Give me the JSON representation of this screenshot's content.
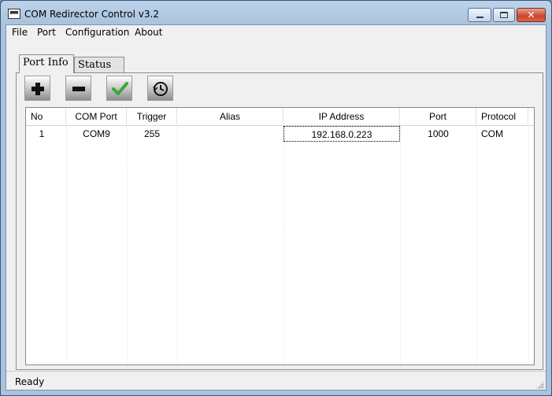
{
  "window": {
    "title": "COM Redirector Control v3.2",
    "min_symbol": "–",
    "max_symbol": "□",
    "close_symbol": "✕"
  },
  "menu": {
    "items": [
      "File",
      "Port",
      "Configuration",
      "About"
    ]
  },
  "tabs": [
    {
      "label": "Port Info",
      "active": true
    },
    {
      "label": "Status",
      "active": false
    }
  ],
  "toolbar": {
    "icons": [
      "add-icon",
      "remove-icon",
      "apply-check-icon",
      "history-clock-icon"
    ]
  },
  "table": {
    "columns": [
      "No",
      "COM Port",
      "Trigger",
      "Alias",
      "IP Address",
      "Port",
      "Protocol"
    ],
    "rows": [
      {
        "no": "1",
        "com_port": "COM9",
        "trigger": "255",
        "alias": "",
        "ip_address": "192.168.0.223",
        "port": "1000",
        "protocol": "COM"
      }
    ]
  },
  "status": {
    "text": "Ready"
  },
  "colors": {
    "titlebar": "#bcd3ea",
    "close_button": "#c9432a",
    "check_green": "#3aa83a"
  }
}
